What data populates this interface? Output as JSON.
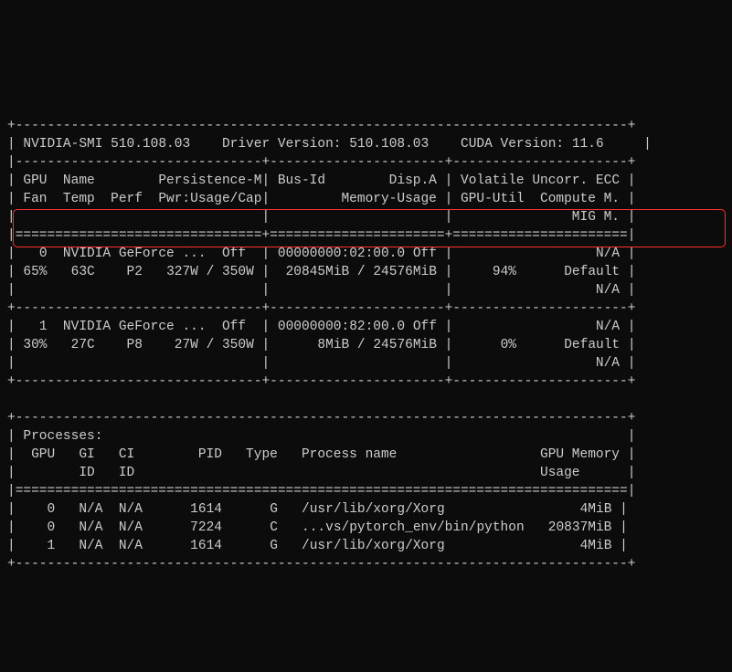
{
  "header": {
    "smi_label": "NVIDIA-SMI",
    "smi_version": "510.108.03",
    "driver_label": "Driver Version:",
    "driver_version": "510.108.03",
    "cuda_label": "CUDA Version:",
    "cuda_version": "11.6"
  },
  "col_headers": {
    "l1_a": "GPU  Name        Persistence-M",
    "l1_b": "Bus-Id        Disp.A",
    "l1_c": "Volatile Uncorr. ECC",
    "l2_a": "Fan  Temp  Perf  Pwr:Usage/Cap",
    "l2_b": "        Memory-Usage",
    "l2_c": "GPU-Util  Compute M.",
    "l3_c": "              MIG M."
  },
  "chart_data": {
    "type": "table",
    "gpus": [
      {
        "index": 0,
        "name": "NVIDIA GeForce ...",
        "persistence": "Off",
        "bus_id": "00000000:02:00.0",
        "disp_a": "Off",
        "ecc": "N/A",
        "fan": "65%",
        "temp": "63C",
        "perf": "P2",
        "pwr_usage": "327W",
        "pwr_cap": "350W",
        "mem_used": "20845MiB",
        "mem_total": "24576MiB",
        "gpu_util": "94%",
        "compute_mode": "Default",
        "mig_mode": "N/A"
      },
      {
        "index": 1,
        "name": "NVIDIA GeForce ...",
        "persistence": "Off",
        "bus_id": "00000000:82:00.0",
        "disp_a": "Off",
        "ecc": "N/A",
        "fan": "30%",
        "temp": "27C",
        "perf": "P8",
        "pwr_usage": "27W",
        "pwr_cap": "350W",
        "mem_used": "8MiB",
        "mem_total": "24576MiB",
        "gpu_util": "0%",
        "compute_mode": "Default",
        "mig_mode": "N/A"
      }
    ],
    "processes": [
      {
        "gpu": 0,
        "gi_id": "N/A",
        "ci_id": "N/A",
        "pid": 1614,
        "type": "G",
        "name": "/usr/lib/xorg/Xorg",
        "mem": "4MiB"
      },
      {
        "gpu": 0,
        "gi_id": "N/A",
        "ci_id": "N/A",
        "pid": 7224,
        "type": "C",
        "name": "...vs/pytorch_env/bin/python",
        "mem": "20837MiB"
      },
      {
        "gpu": 1,
        "gi_id": "N/A",
        "ci_id": "N/A",
        "pid": 1614,
        "type": "G",
        "name": "/usr/lib/xorg/Xorg",
        "mem": "4MiB"
      }
    ]
  },
  "proc_header": {
    "title": "Processes:",
    "l1": " GPU   GI   CI        PID   Type   Process name                  GPU Memory ",
    "l2": "       ID   ID                                                   Usage      "
  }
}
